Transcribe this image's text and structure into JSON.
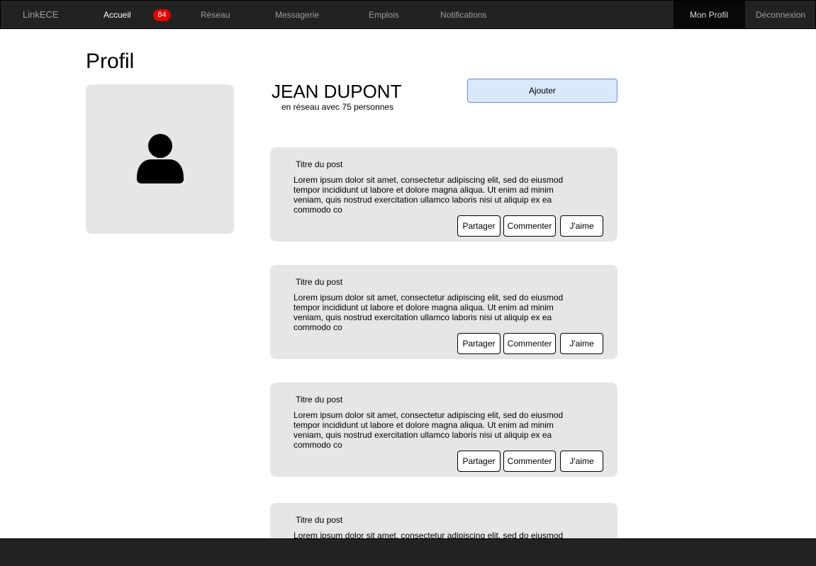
{
  "navbar": {
    "brand": "LinkECE",
    "accueil": "Accueil",
    "badge_count": "84",
    "reseau": "Réseau",
    "messagerie": "Messagerie",
    "emplois": "Emplois",
    "notifications": "Notifications",
    "mon_profil": "Mon Profil",
    "deconnexion": "Déconnexion"
  },
  "page": {
    "title": "Profil"
  },
  "profile": {
    "name": "JEAN DUPONT",
    "network": "en réseau avec 75 personnes",
    "add_label": "Ajouter",
    "avatar_icon": "user-icon"
  },
  "posts": [
    {
      "title": "Titre du post",
      "body": "Lorem ipsum dolor sit amet, consectetur adipiscing elit, sed do eiusmod tempor incididunt ut labore et dolore magna aliqua. Ut enim ad minim veniam, quis nostrud exercitation ullamco laboris nisi ut aliquip ex ea commodo co",
      "share": "Partager",
      "comment": "Commenter",
      "like": "J'aime"
    },
    {
      "title": "Titre du post",
      "body": "Lorem ipsum dolor sit amet, consectetur adipiscing elit, sed do eiusmod tempor incididunt ut labore et dolore magna aliqua. Ut enim ad minim veniam, quis nostrud exercitation ullamco laboris nisi ut aliquip ex ea commodo co",
      "share": "Partager",
      "comment": "Commenter",
      "like": "J'aime"
    },
    {
      "title": "Titre du post",
      "body": "Lorem ipsum dolor sit amet, consectetur adipiscing elit, sed do eiusmod tempor incididunt ut labore et dolore magna aliqua. Ut enim ad minim veniam, quis nostrud exercitation ullamco laboris nisi ut aliquip ex ea commodo co",
      "share": "Partager",
      "comment": "Commenter",
      "like": "J'aime"
    },
    {
      "title": "Titre du post",
      "body": "Lorem ipsum dolor sit amet, consectetur adipiscing elit, sed do eiusmod"
    }
  ],
  "colors": {
    "navbar_bg": "#222222",
    "badge_bg": "#e00000",
    "add_button_bg": "#dae8fc",
    "add_button_border": "#6c8ebf",
    "card_bg": "#e6e6e6"
  }
}
